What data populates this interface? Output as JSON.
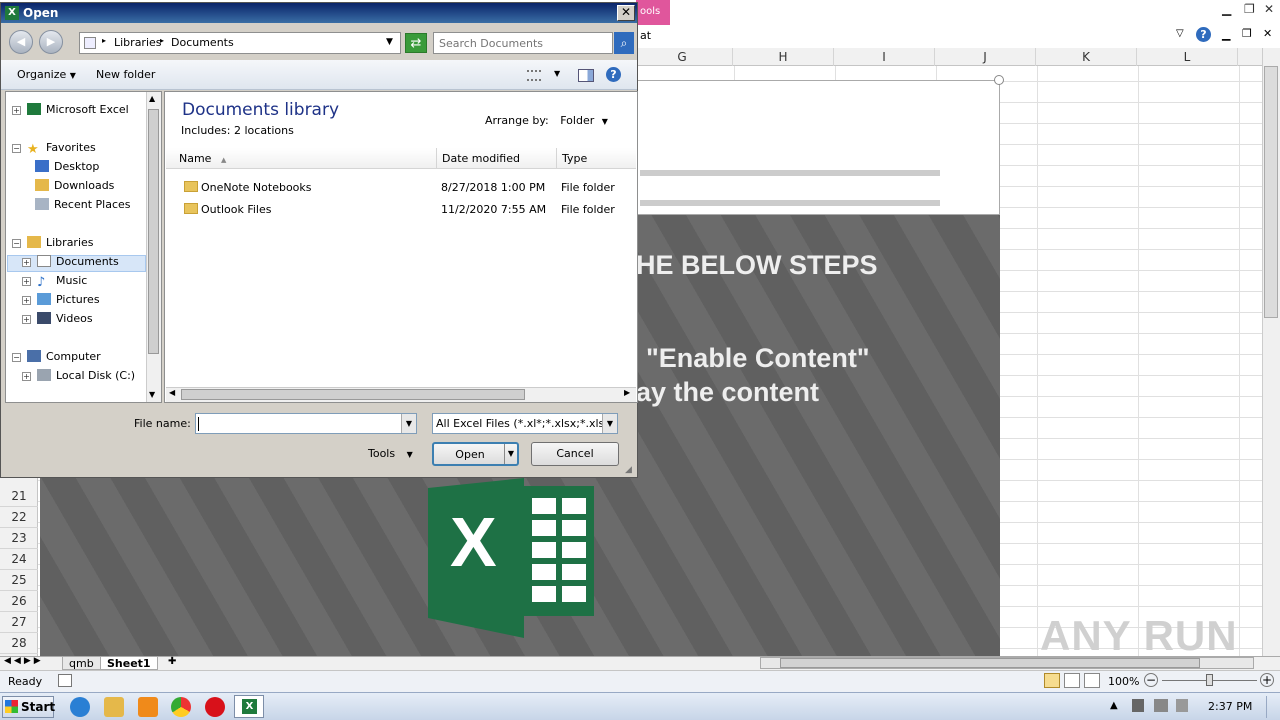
{
  "excel": {
    "ribbon_tab_fragment": "ools",
    "ribbon_fragment": "at",
    "columns": [
      "G",
      "H",
      "I",
      "J",
      "K",
      "L"
    ],
    "rows": [
      "21",
      "22",
      "23",
      "24",
      "25",
      "26",
      "27",
      "28"
    ],
    "content_line1": "HE BELOW STEPS",
    "content_line2": "\"Enable Content\"",
    "content_line3": "ay the content",
    "sheets": [
      "qmb",
      "Sheet1"
    ],
    "status": "Ready",
    "zoom": "100%",
    "watermark": "ANY RUN"
  },
  "taskbar": {
    "start": "Start",
    "clock": "2:37 PM"
  },
  "dialog": {
    "title": "Open",
    "close_glyph": "✕",
    "address": {
      "part1": "Libraries",
      "part2": "Documents",
      "sep": "▸"
    },
    "search_placeholder": "Search Documents",
    "organize": "Organize",
    "new_folder": "New folder",
    "nav": {
      "microsoft_excel": "Microsoft Excel",
      "favorites": "Favorites",
      "desktop": "Desktop",
      "downloads": "Downloads",
      "recent_places": "Recent Places",
      "libraries": "Libraries",
      "documents": "Documents",
      "music": "Music",
      "pictures": "Pictures",
      "videos": "Videos",
      "computer": "Computer",
      "local_disk": "Local Disk (C:)"
    },
    "library_title": "Documents library",
    "library_includes_label": "Includes:",
    "library_includes_value": "2 locations",
    "arrange_label": "Arrange by:",
    "arrange_value": "Folder",
    "columns": {
      "name": "Name",
      "date": "Date modified",
      "type": "Type"
    },
    "files": [
      {
        "name": "OneNote Notebooks",
        "date": "8/27/2018 1:00 PM",
        "type": "File folder"
      },
      {
        "name": "Outlook Files",
        "date": "11/2/2020 7:55 AM",
        "type": "File folder"
      }
    ],
    "file_name_label": "File name:",
    "file_name_value": "",
    "file_type": "All Excel Files (*.xl*;*.xlsx;*.xlsm;",
    "tools": "Tools",
    "open": "Open",
    "cancel": "Cancel"
  }
}
